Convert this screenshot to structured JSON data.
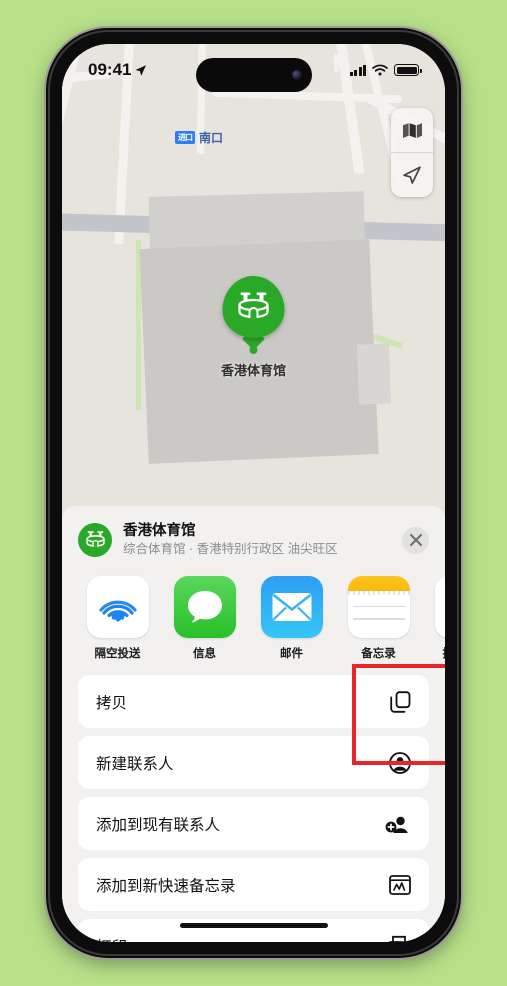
{
  "background_color": "#b7e089",
  "status_bar": {
    "time": "09:41",
    "location_arrow_icon": "location-arrow-icon",
    "signal_icon": "cellular-bars-icon",
    "wifi_icon": "wifi-icon",
    "battery_icon": "battery-icon"
  },
  "map": {
    "label_badge": "进口",
    "label_text": "南口",
    "pin_label": "香港体育馆",
    "pin_icon": "stadium-icon",
    "pin_color": "#2aa929",
    "controls": [
      {
        "name": "map-type-button",
        "icon": "folded-map-icon"
      },
      {
        "name": "current-location-button",
        "icon": "location-arrow-icon"
      }
    ]
  },
  "share_sheet": {
    "title": "香港体育馆",
    "subtitle": "综合体育馆 · 香港特别行政区 油尖旺区",
    "avatar_icon": "stadium-icon",
    "close_icon": "close-icon",
    "apps": [
      {
        "label": "隔空投送",
        "icon": "airdrop-icon",
        "highlighted": false
      },
      {
        "label": "信息",
        "icon": "messages-icon",
        "highlighted": false
      },
      {
        "label": "邮件",
        "icon": "mail-icon",
        "highlighted": false
      },
      {
        "label": "备忘录",
        "icon": "notes-icon",
        "highlighted": true
      },
      {
        "label": "提醒事项",
        "icon": "shortcuts-icon",
        "highlighted": false
      }
    ],
    "actions": [
      {
        "label": "拷贝",
        "icon": "copy-icon"
      },
      {
        "label": "新建联系人",
        "icon": "person-circle-icon"
      },
      {
        "label": "添加到现有联系人",
        "icon": "person-add-icon"
      },
      {
        "label": "添加到新快速备忘录",
        "icon": "quick-note-icon"
      },
      {
        "label": "打印",
        "icon": "printer-icon"
      }
    ],
    "highlight_color": "#e8262a"
  }
}
